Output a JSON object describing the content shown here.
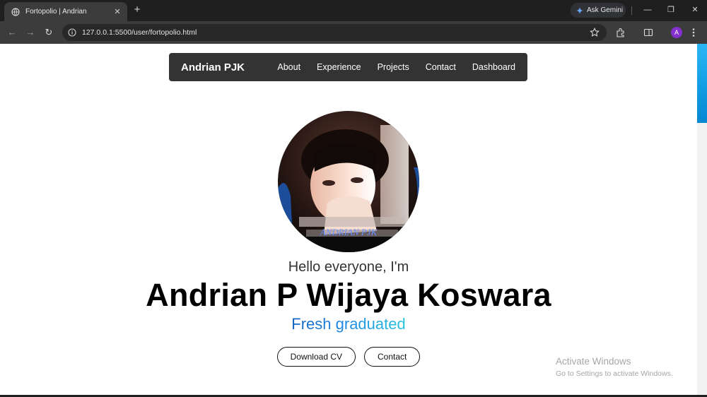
{
  "browser": {
    "tab_title": "Fortopolio | Andrian",
    "tab_close": "✕",
    "new_tab": "+",
    "url": "127.0.0.1:5500/user/fortopolio.html",
    "gemini_label": "Ask Gemini",
    "avatar_initial": "A",
    "minimize": "—",
    "restore": "❐",
    "close": "✕",
    "back": "←",
    "forward": "→",
    "reload": "↻"
  },
  "navbar": {
    "brand": "Andrian PJK",
    "links": [
      "About",
      "Experience",
      "Projects",
      "Contact",
      "Dashboard"
    ]
  },
  "hero": {
    "greeting": "Hello everyone, I'm",
    "name": "Andrian P Wijaya Koswara",
    "role": "Fresh graduated",
    "photo_watermark": "ANDRIAN PJK",
    "buttons": {
      "download_cv": "Download CV",
      "contact": "Contact"
    }
  },
  "os_watermark": {
    "title": "Activate Windows",
    "subtitle": "Go to Settings to activate Windows."
  },
  "colors": {
    "navbar_bg": "#333333",
    "accent_gradient_start": "#1565c0",
    "accent_gradient_end": "#26c6da",
    "scroll_thumb": "#29b6f6"
  }
}
